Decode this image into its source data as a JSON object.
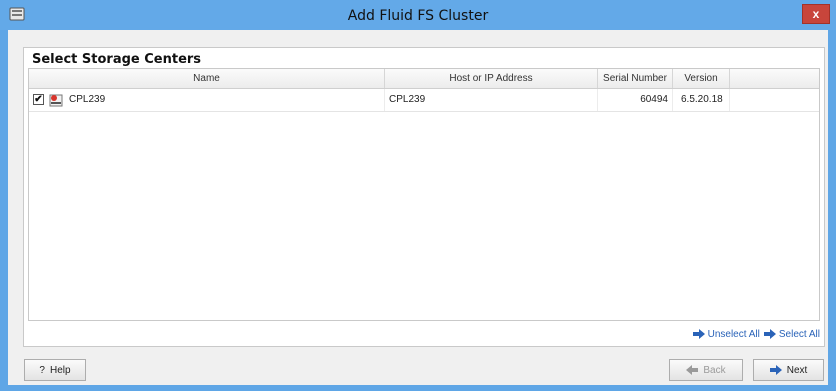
{
  "window": {
    "title": "Add Fluid FS Cluster",
    "close_label": "x"
  },
  "panel": {
    "title": "Select Storage Centers"
  },
  "grid": {
    "columns": [
      "Name",
      "Host or IP Address",
      "Serial Number",
      "Version"
    ],
    "rows": [
      {
        "checked": true,
        "check_mark": "✔",
        "name": "CPL239",
        "host": "CPL239",
        "serial": "60494",
        "version": "6.5.20.18"
      }
    ]
  },
  "links": {
    "unselect_all": "Unselect All",
    "select_all": "Select All"
  },
  "buttons": {
    "help": "Help",
    "help_glyph": "?",
    "back": "Back",
    "next": "Next"
  },
  "colors": {
    "titlebar": "#63a9e8",
    "close": "#c8453b",
    "link": "#2a63b8",
    "arrow": "#2a63b8"
  }
}
